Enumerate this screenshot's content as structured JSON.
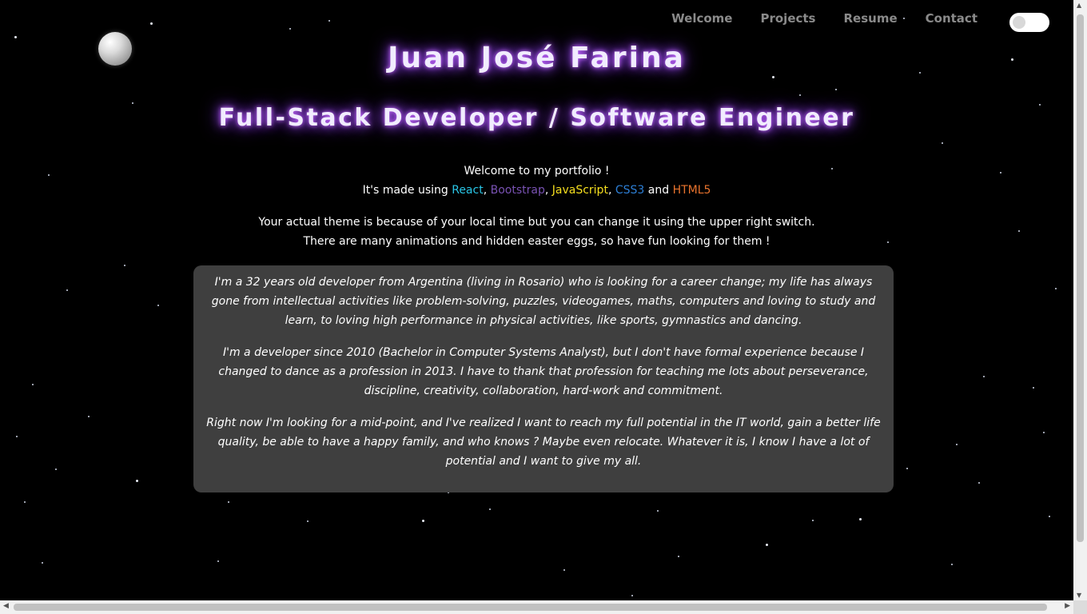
{
  "nav": {
    "items": [
      {
        "label": "Welcome"
      },
      {
        "label": "Projects"
      },
      {
        "label": "Resume"
      },
      {
        "label": "Contact"
      }
    ]
  },
  "header": {
    "name": "Juan José Farina",
    "role": "Full-Stack Developer / Software Engineer"
  },
  "intro": {
    "welcome": "Welcome to my portfolio !",
    "made_using_prefix": "It's made using ",
    "tech": [
      "React",
      "Bootstrap",
      "JavaScript",
      "CSS3",
      "HTML5"
    ],
    "sep": ", ",
    "and": " and ",
    "theme_line": "Your actual theme is because of your local time but you can change it using the upper right switch.",
    "easter_line": "There are many animations and hidden easter eggs, so have fun looking for them !"
  },
  "about": {
    "paragraphs": [
      "I'm a 32 years old developer from Argentina (living in Rosario) who is looking for a career change; my life has always gone from intellectual activities like problem-solving, puzzles, videogames, maths, computers and loving to study and learn, to loving high performance in physical activities, like sports, gymnastics and dancing.",
      "I'm a developer since 2010 (Bachelor in Computer Systems Analyst), but I don't have formal experience because I changed to dance as a profession in 2013. I have to thank that profession for teaching me lots about perseverance, discipline, creativity, collaboration, hard-work and commitment.",
      "Right now I'm looking for a mid-point, and I've realized I want to reach my full potential in the IT world, gain a better life quality, be able to have a happy family, and who knows ? Maybe even relocate. Whatever it is, I know I have a lot of potential and I want to give my all."
    ]
  },
  "theme_toggle": {
    "state": "off"
  },
  "colors": {
    "background": "#000000",
    "card": "#3f3f3f",
    "title_glow": "#a14bff",
    "react": "#29c5e6",
    "bootstrap": "#7952b3",
    "javascript": "#f7df1e",
    "css3": "#2d7fd6",
    "html5": "#e8732d"
  },
  "icons": {
    "moon": "moon-icon",
    "theme_switch": "toggle-switch-icon"
  }
}
